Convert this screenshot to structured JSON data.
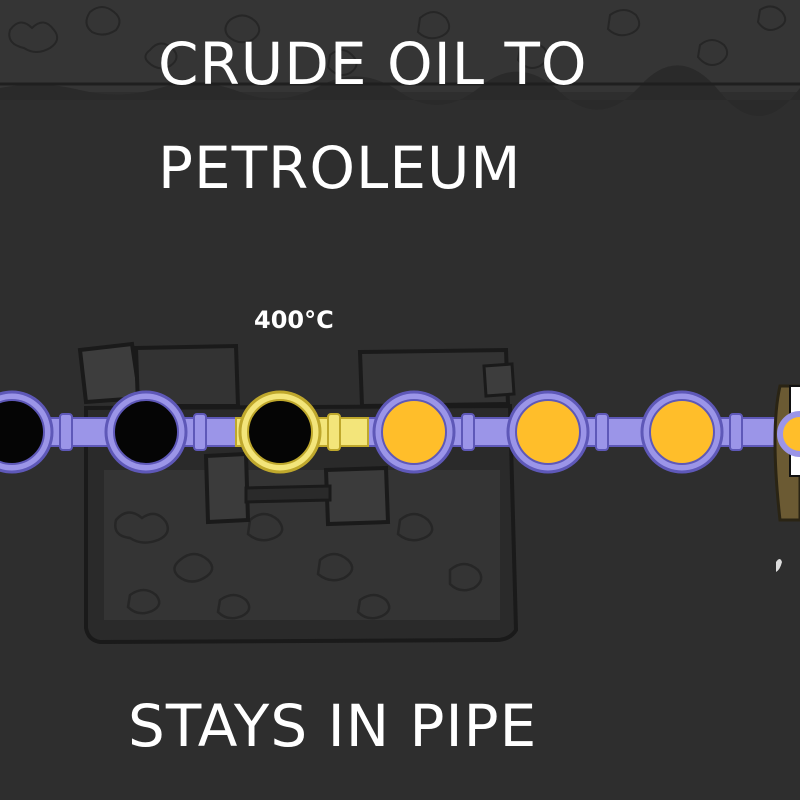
{
  "title": {
    "line1": "CRUDE OIL TO",
    "line2": "PETROLEUM"
  },
  "temperature_label": "400°C",
  "bottom_caption": "STAYS IN PIPE",
  "colors": {
    "background": "#2e2e2e",
    "pipe": "#9b95e8",
    "pipe_highlight": "#f3e57a",
    "crude_oil": "#050505",
    "petroleum": "#ffbe2a",
    "building": "#3b3b3b"
  },
  "pipe_segments": [
    {
      "content": "crude-oil",
      "highlighted": false
    },
    {
      "content": "crude-oil",
      "highlighted": false
    },
    {
      "content": "crude-oil",
      "highlighted": true
    },
    {
      "content": "petroleum",
      "highlighted": false
    },
    {
      "content": "petroleum",
      "highlighted": false
    },
    {
      "content": "petroleum",
      "highlighted": false
    },
    {
      "content": "petroleum",
      "highlighted": false
    }
  ]
}
